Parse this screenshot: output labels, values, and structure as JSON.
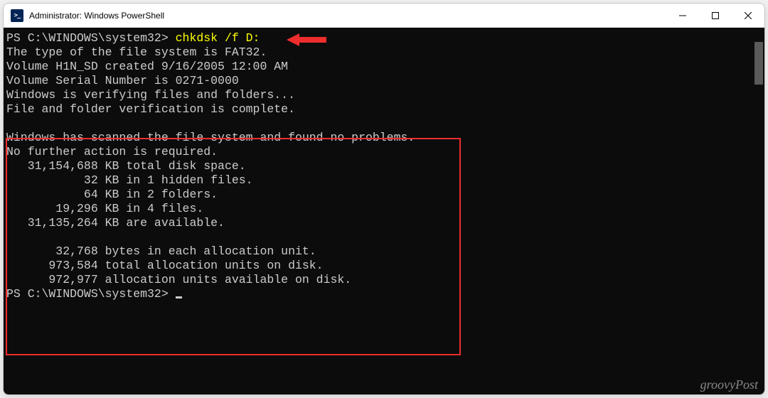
{
  "window": {
    "title": "Administrator: Windows PowerShell"
  },
  "terminal": {
    "prompt1_path": "PS C:\\WINDOWS\\system32> ",
    "prompt1_command": "chkdsk /f D:",
    "line1": "The type of the file system is FAT32.",
    "line2": "Volume H1N_SD created 9/16/2005 12:00 AM",
    "line3": "Volume Serial Number is 0271-0000",
    "line4": "Windows is verifying files and folders...",
    "line5": "File and folder verification is complete.",
    "line6": "",
    "line7": "Windows has scanned the file system and found no problems.",
    "line8": "No further action is required.",
    "line9": "   31,154,688 KB total disk space.",
    "line10": "           32 KB in 1 hidden files.",
    "line11": "           64 KB in 2 folders.",
    "line12": "       19,296 KB in 4 files.",
    "line13": "   31,135,264 KB are available.",
    "line14": "",
    "line15": "       32,768 bytes in each allocation unit.",
    "line16": "      973,584 total allocation units on disk.",
    "line17": "      972,977 allocation units available on disk.",
    "prompt2_path": "PS C:\\WINDOWS\\system32> "
  },
  "annotation": {
    "arrow_color": "#ef2d2d",
    "box_color": "#ef2d2d"
  },
  "watermark": "groovyPost"
}
